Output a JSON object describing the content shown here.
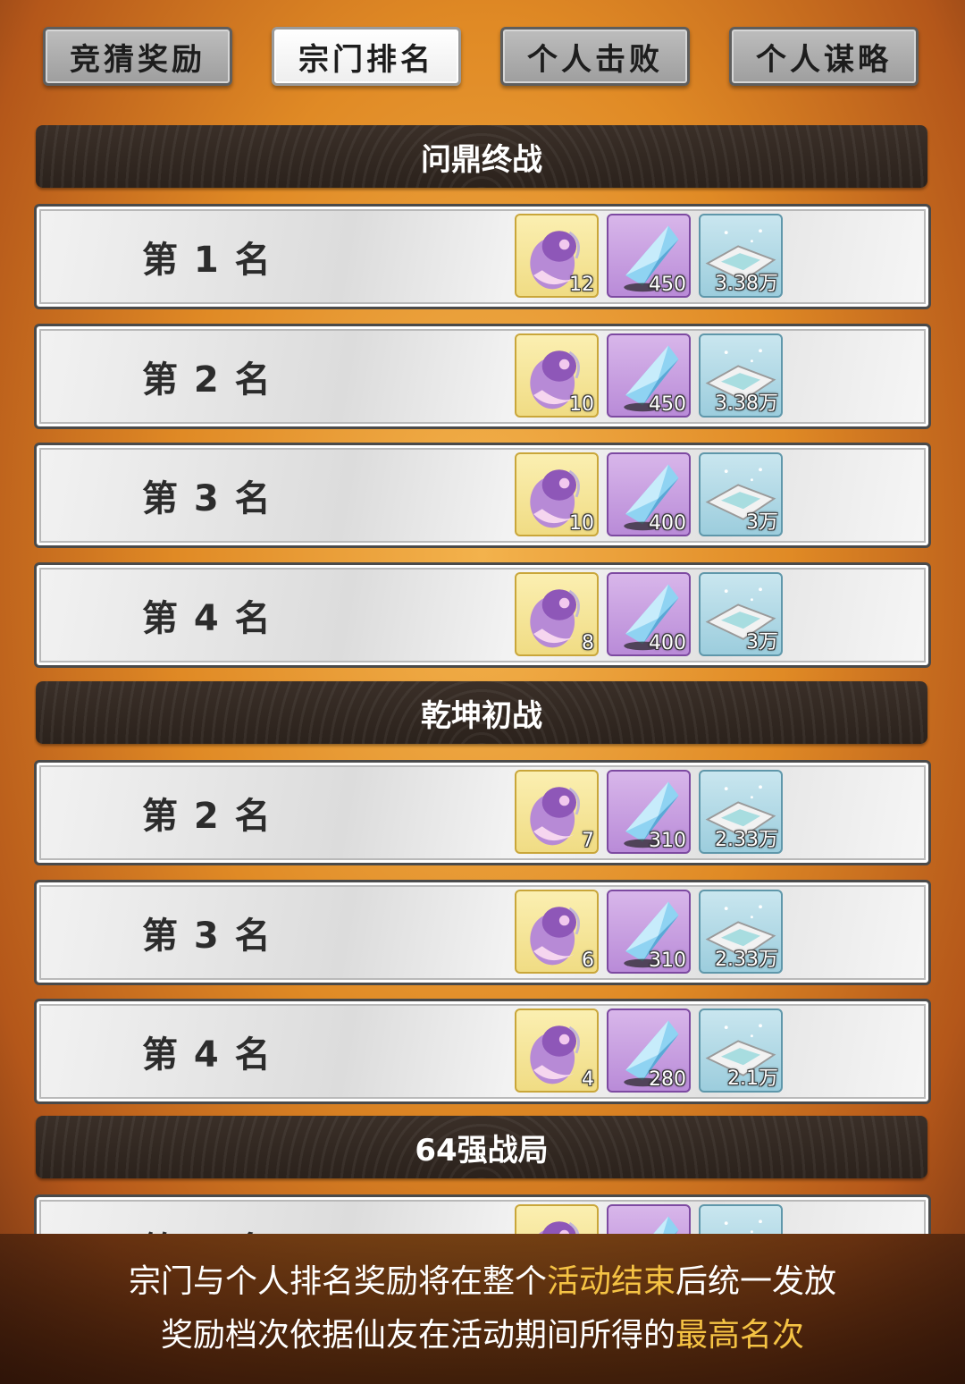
{
  "tabs": [
    {
      "label": "竞猜奖励",
      "active": false
    },
    {
      "label": "宗门排名",
      "active": true
    },
    {
      "label": "个人击败",
      "active": false
    },
    {
      "label": "个人谋略",
      "active": false
    }
  ],
  "sections": [
    {
      "title": "问鼎终战"
    },
    {
      "title": "乾坤初战"
    },
    {
      "title": "64强战局"
    }
  ],
  "rows": [
    {
      "rank": "第 1 名",
      "rewards": [
        "12",
        "450",
        "3.38万"
      ]
    },
    {
      "rank": "第 2 名",
      "rewards": [
        "10",
        "450",
        "3.38万"
      ]
    },
    {
      "rank": "第 3 名",
      "rewards": [
        "10",
        "400",
        "3万"
      ]
    },
    {
      "rank": "第 4 名",
      "rewards": [
        "8",
        "400",
        "3万"
      ]
    },
    {
      "rank": "第 2 名",
      "rewards": [
        "7",
        "310",
        "2.33万"
      ]
    },
    {
      "rank": "第 3 名",
      "rewards": [
        "6",
        "310",
        "2.33万"
      ]
    },
    {
      "rank": "第 4 名",
      "rewards": [
        "4",
        "280",
        "2.1万"
      ]
    },
    {
      "rank": "第 2 名",
      "rewards": [
        "",
        "",
        ""
      ]
    }
  ],
  "reward_icons": [
    "purple-tentacle-icon",
    "blue-crystal-icon",
    "silver-ingot-icon"
  ],
  "footer": {
    "line1_a": "宗门与个人排名奖励将在整个",
    "line1_hl": "活动结束",
    "line1_b": "后统一发放",
    "line2_a": "奖励档次依据仙友在活动期间所得的",
    "line2_hl": "最高名次"
  },
  "colors": {
    "highlight": "#f5c344",
    "header_bg": "#2f2620"
  }
}
